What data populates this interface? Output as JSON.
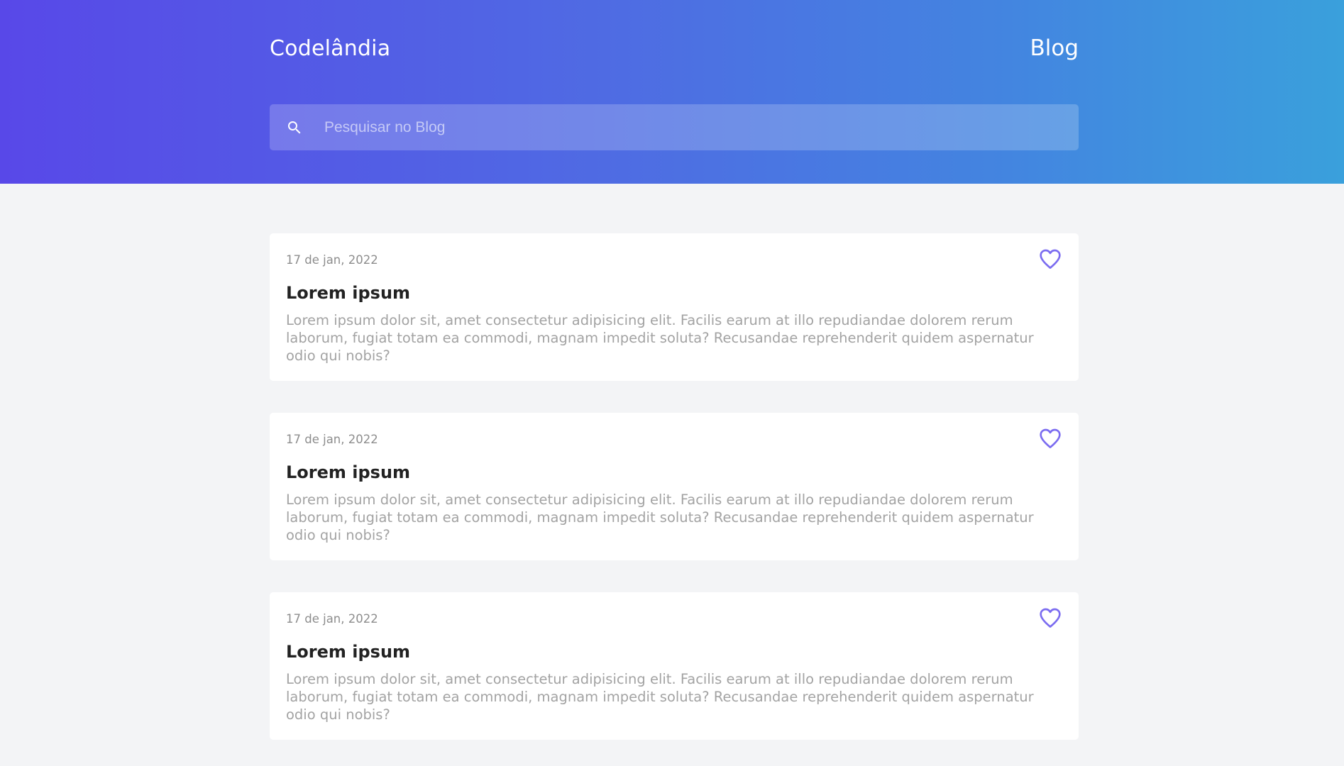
{
  "header": {
    "brand": "Codelândia",
    "nav_link": "Blog",
    "search_placeholder": "Pesquisar no Blog",
    "search_icon": "search-icon",
    "gradient_colors": [
      "#5848e8",
      "#3aa0dc"
    ]
  },
  "posts": [
    {
      "date": "17 de jan, 2022",
      "title": "Lorem ipsum",
      "body": "Lorem ipsum dolor sit, amet consectetur adipisicing elit. Facilis earum at illo repudiandae dolorem rerum laborum, fugiat totam ea commodi, magnam impedit soluta? Recusandae reprehenderit quidem aspernatur odio qui nobis?",
      "icon": "heart-icon"
    },
    {
      "date": "17 de jan, 2022",
      "title": "Lorem ipsum",
      "body": "Lorem ipsum dolor sit, amet consectetur adipisicing elit. Facilis earum at illo repudiandae dolorem rerum laborum, fugiat totam ea commodi, magnam impedit soluta? Recusandae reprehenderit quidem aspernatur odio qui nobis?",
      "icon": "heart-icon"
    },
    {
      "date": "17 de jan, 2022",
      "title": "Lorem ipsum",
      "body": "Lorem ipsum dolor sit, amet consectetur adipisicing elit. Facilis earum at illo repudiandae dolorem rerum laborum, fugiat totam ea commodi, magnam impedit soluta? Recusandae reprehenderit quidem aspernatur odio qui nobis?",
      "icon": "heart-icon"
    }
  ],
  "colors": {
    "accent": "#7b6cf0",
    "page_background": "#f3f4f6",
    "card_background": "#ffffff"
  }
}
